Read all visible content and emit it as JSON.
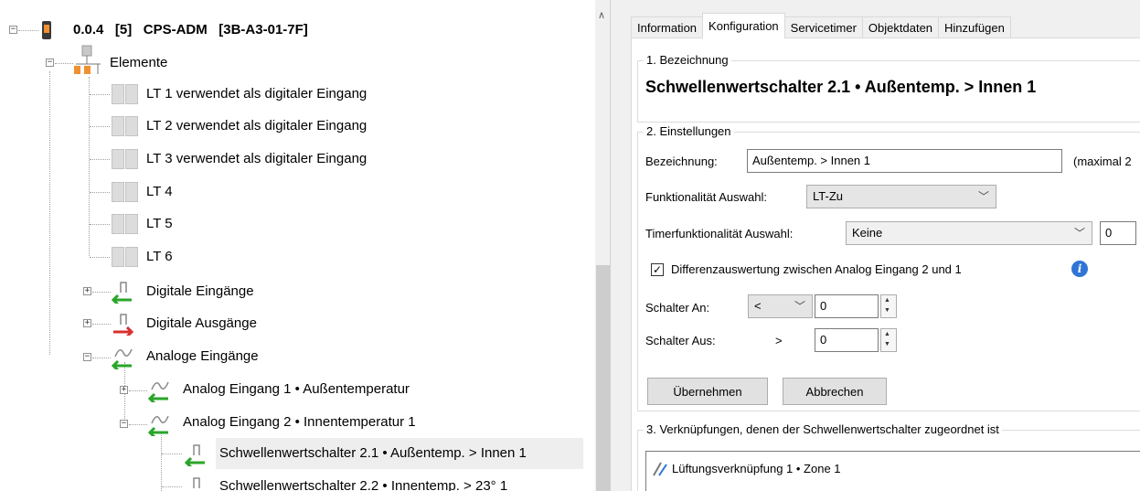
{
  "tree": {
    "root": {
      "address": "0.0.4",
      "index": "[5]",
      "name": "CPS-ADM",
      "code": "[3B-A3-01-7F]"
    },
    "elemente": "Elemente",
    "lt_items": [
      "LT 1 verwendet als digitaler Eingang",
      "LT 2 verwendet als digitaler Eingang",
      "LT 3 verwendet als digitaler Eingang",
      "LT 4",
      "LT 5",
      "LT 6"
    ],
    "digitale_eingaenge": "Digitale Eingänge",
    "digitale_ausgaenge": "Digitale Ausgänge",
    "analoge_eingaenge": "Analoge Eingänge",
    "analog1": "Analog Eingang 1 • Außentemperatur",
    "analog2": "Analog Eingang 2 • Innentemperatur 1",
    "sw21": "Schwellenwertschalter 2.1 • Außentemp. > Innen 1",
    "sw22": "Schwellenwertschalter 2.2 • Innentemp. > 23° 1"
  },
  "tabs": [
    "Information",
    "Konfiguration",
    "Servicetimer",
    "Objektdaten",
    "Hinzufügen"
  ],
  "section1": {
    "title": "1. Bezeichnung",
    "heading": "Schwellenwertschalter 2.1 • Außentemp. > Innen 1"
  },
  "section2": {
    "title": "2. Einstellungen",
    "bezeichnung_label": "Bezeichnung:",
    "bezeichnung_value": "Außentemp. > Innen 1",
    "max_note": "(maximal 2",
    "funktion_label": "Funktionalität Auswahl:",
    "funktion_value": "LT-Zu",
    "timer_label": "Timerfunktionalität Auswahl:",
    "timer_value": "Keine",
    "timer_number": "0",
    "diff_label": "Differenzauswertung zwischen Analog Eingang 2 und 1",
    "diff_checked": true,
    "schalter_an_label": "Schalter An:",
    "schalter_an_op": "<",
    "schalter_an_value": "0",
    "schalter_aus_label": "Schalter Aus:",
    "schalter_aus_op": ">",
    "schalter_aus_value": "0",
    "apply": "Übernehmen",
    "cancel": "Abbrechen"
  },
  "section3": {
    "title": "3. Verknüpfungen, denen der Schwellenwertschalter zugeordnet ist",
    "items": [
      "Lüftungsverknüpfung 1 • Zone 1"
    ]
  },
  "colors": {
    "green_arrow": "#2aa52a",
    "red_arrow": "#d83030",
    "info_blue": "#2f75d6",
    "device_orange": "#f09030"
  }
}
